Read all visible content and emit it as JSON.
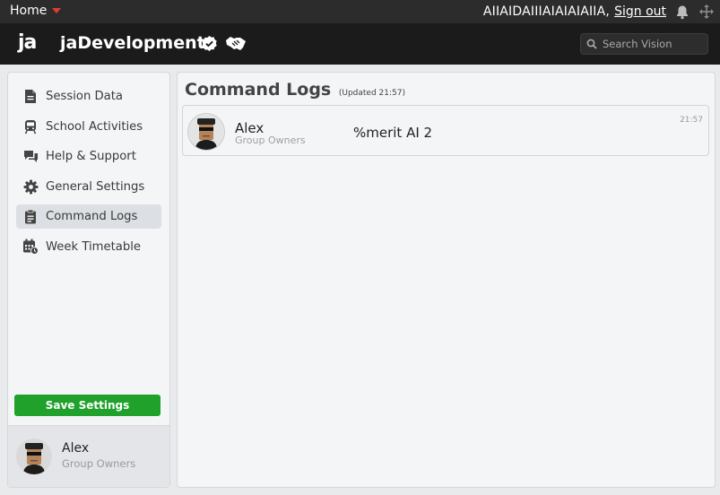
{
  "topbar": {
    "home_label": "Home",
    "username": "AIIAIDAIIIAIAIAIAIIA,",
    "signout_label": "Sign out"
  },
  "header": {
    "logo_text": "ja",
    "brand": "jaDevelopment",
    "search_placeholder": "Search Vision"
  },
  "sidebar": {
    "items": [
      {
        "label": "Session Data",
        "icon": "document-icon"
      },
      {
        "label": "School Activities",
        "icon": "train-icon"
      },
      {
        "label": "Help & Support",
        "icon": "chat-icon"
      },
      {
        "label": "General Settings",
        "icon": "gear-icon"
      },
      {
        "label": "Command Logs",
        "icon": "clipboard-icon",
        "active": true
      },
      {
        "label": "Week Timetable",
        "icon": "calendar-clock-icon"
      }
    ],
    "save_label": "Save Settings",
    "profile": {
      "name": "Alex",
      "role": "Group Owners"
    }
  },
  "main": {
    "title": "Command Logs",
    "updated": "(Updated 21:57)",
    "logs": [
      {
        "name": "Alex",
        "role": "Group Owners",
        "command": "%merit AI 2",
        "time": "21:57"
      }
    ]
  },
  "colors": {
    "save_button": "#1fa12b",
    "topbar": "#2c2c2c",
    "header": "#1b1b1b",
    "home_caret": "#e53935"
  }
}
